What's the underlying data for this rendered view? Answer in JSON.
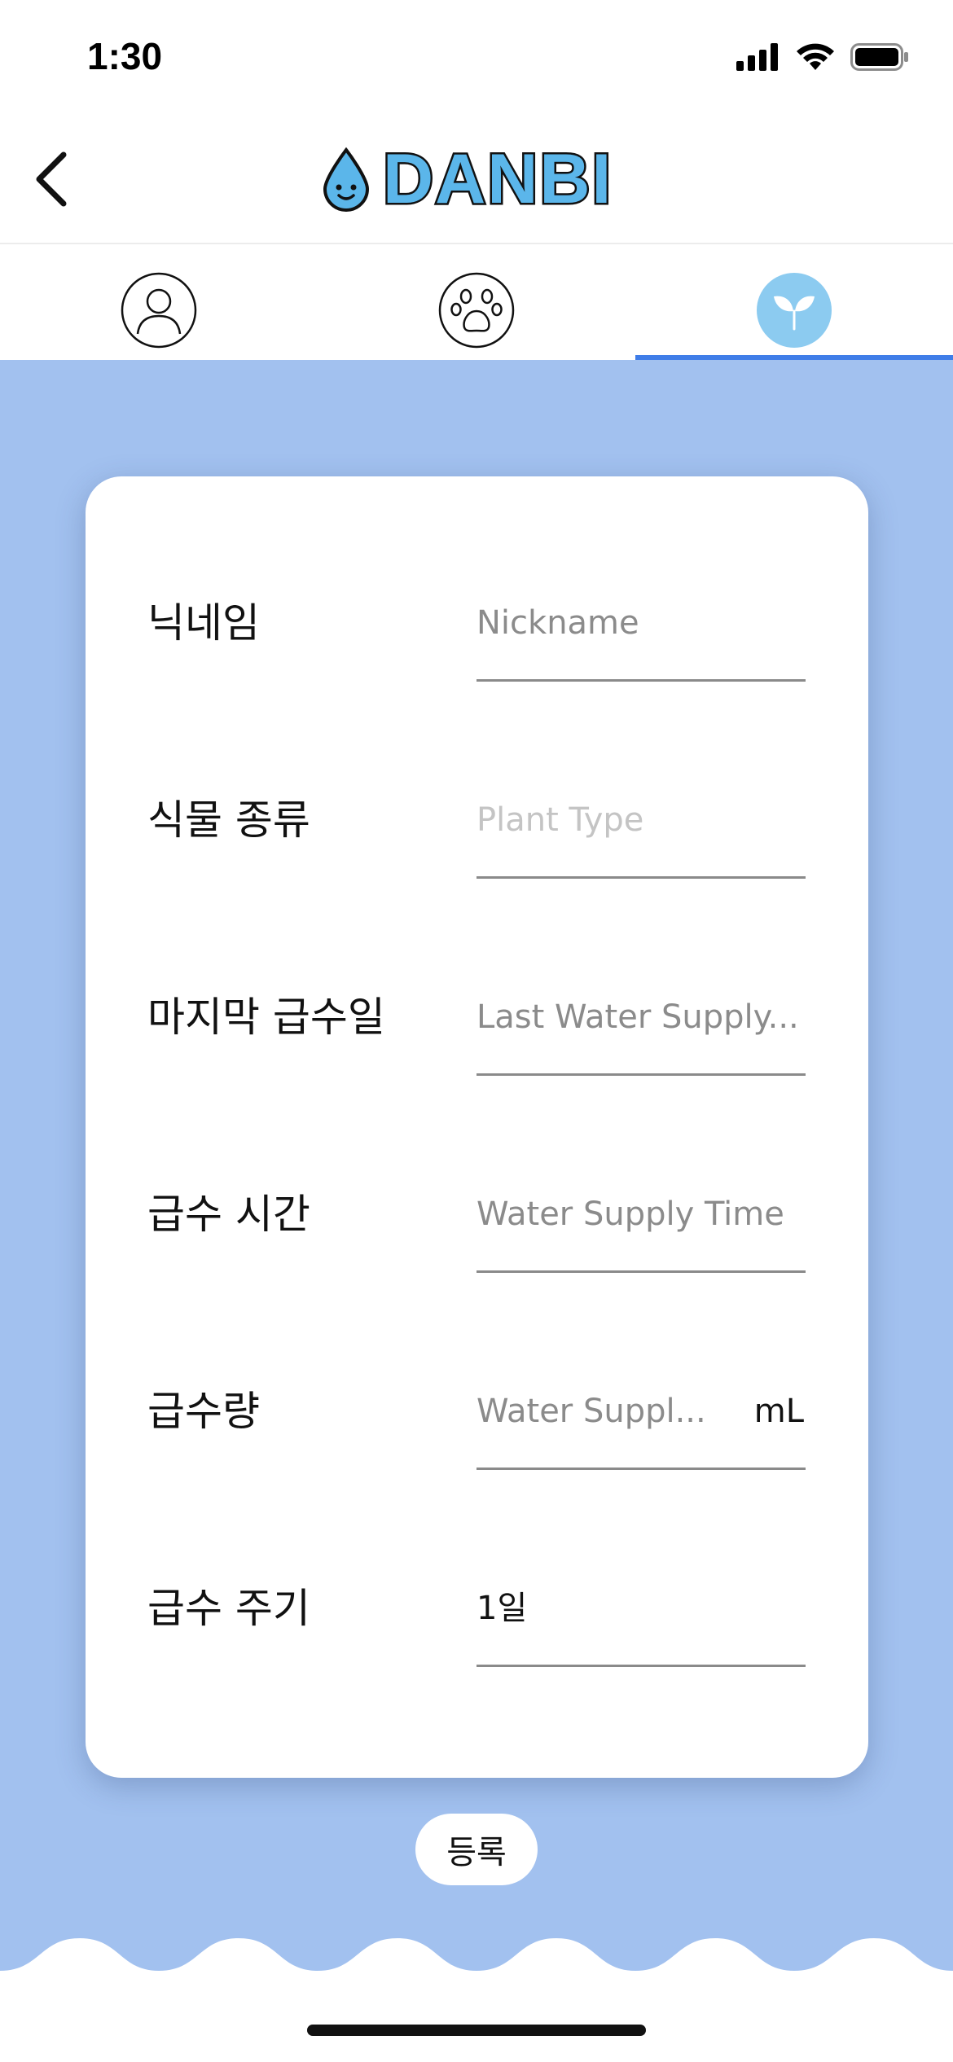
{
  "status_bar": {
    "time": "1:30",
    "icons": [
      "signal-icon",
      "wifi-icon",
      "battery-icon"
    ]
  },
  "header": {
    "back_icon": "chevron-left-icon",
    "logo_text": "DANBI",
    "logo_icon": "water-drop-icon"
  },
  "tabs": [
    {
      "icon": "user-icon",
      "active": false
    },
    {
      "icon": "paw-icon",
      "active": false
    },
    {
      "icon": "sprout-icon",
      "active": true
    }
  ],
  "form": {
    "rows": [
      {
        "label": "닉네임",
        "placeholder": "Nickname"
      },
      {
        "label": "식물 종류",
        "placeholder": "Plant Type"
      },
      {
        "label": "마지막 급수일",
        "placeholder": "Last Water Supply..."
      },
      {
        "label": "급수 시간",
        "placeholder": "Water Supply Time"
      },
      {
        "label": "급수량",
        "placeholder": "Water Suppl...",
        "unit": "mL"
      },
      {
        "label": "급수 주기",
        "value": "1일"
      }
    ]
  },
  "submit_label": "등록",
  "colors": {
    "background_blue": "#a2c1ef",
    "tab_active_indicator": "#3f7de8",
    "logo_blue": "#5bb6ea",
    "active_tab_circle": "#8ccbf0"
  }
}
